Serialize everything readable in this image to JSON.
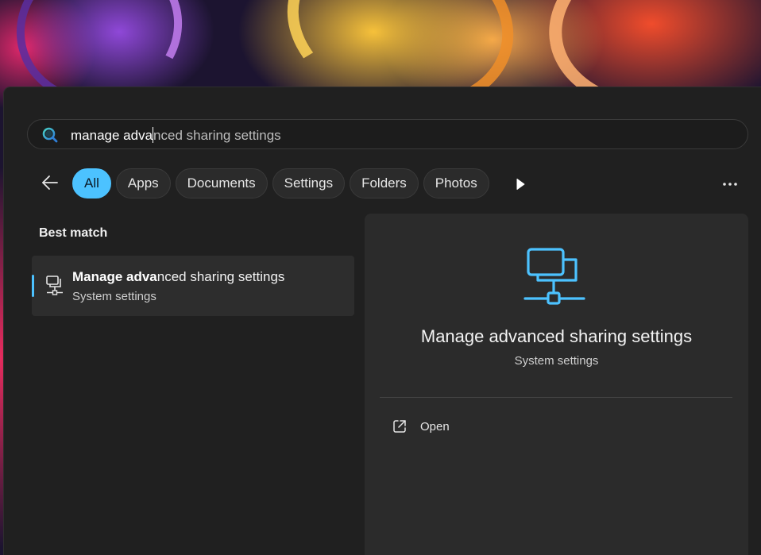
{
  "search": {
    "typed": "manage adva",
    "completion": "nced sharing settings"
  },
  "filters": [
    {
      "label": "All",
      "active": true
    },
    {
      "label": "Apps",
      "active": false
    },
    {
      "label": "Documents",
      "active": false
    },
    {
      "label": "Settings",
      "active": false
    },
    {
      "label": "Folders",
      "active": false
    },
    {
      "label": "Photos",
      "active": false
    }
  ],
  "results": {
    "heading": "Best match",
    "best_match": {
      "title_bold": "Manage adva",
      "title_rest": "nced sharing settings",
      "subtitle": "System settings",
      "icon": "network-share-icon"
    }
  },
  "detail": {
    "title": "Manage advanced sharing settings",
    "subtitle": "System settings",
    "icon": "network-share-icon",
    "actions": [
      {
        "label": "Open",
        "icon": "open-external-icon"
      }
    ]
  },
  "colors": {
    "accent": "#4cc2ff",
    "panel_bg": "#202020",
    "detail_bg": "#2b2b2b"
  }
}
